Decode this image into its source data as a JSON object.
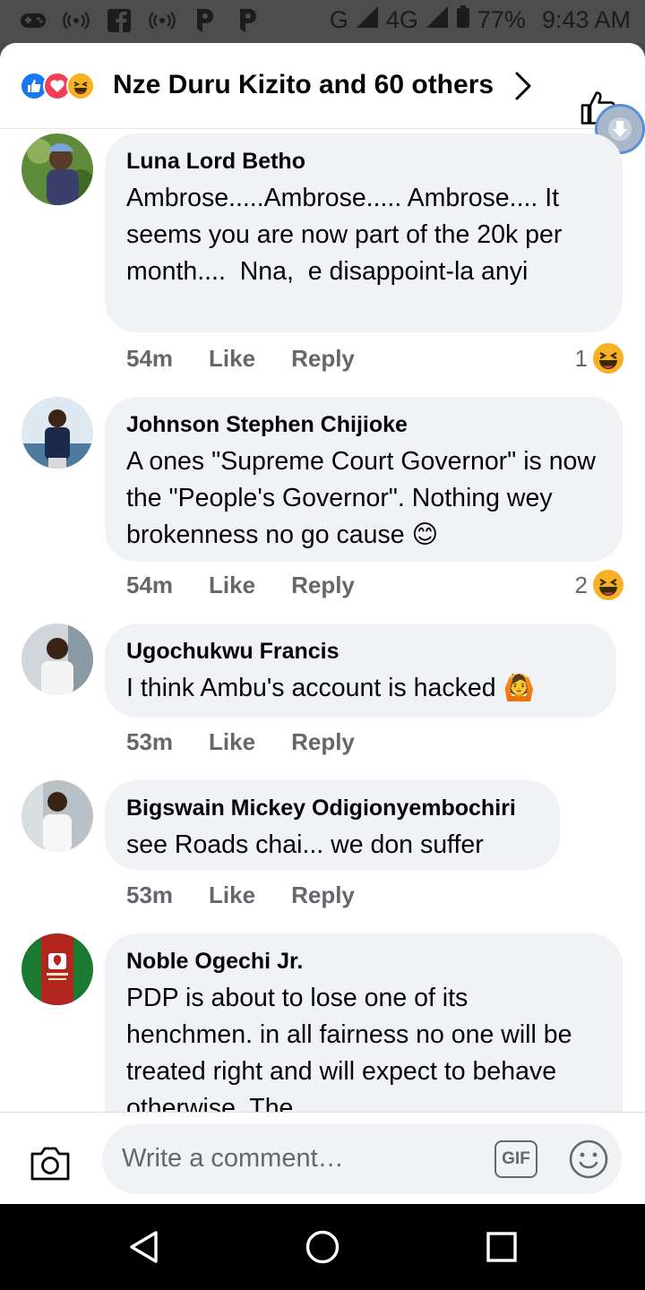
{
  "status_bar": {
    "network": "G",
    "network2": "4G",
    "battery": "77%",
    "time": "9:43 AM"
  },
  "header": {
    "title": "Nze Duru Kizito and 60 others",
    "reaction_icons": [
      "like-icon",
      "love-icon",
      "haha-icon"
    ]
  },
  "comments": [
    {
      "name": "Luna Lord Betho",
      "text": "Ambrose.....Ambrose..... Ambrose.... It seems you are now part of the 20k per month....  Nna,  e disappoint-la anyi",
      "time": "54m",
      "like": "Like",
      "reply": "Reply",
      "reactions": "1"
    },
    {
      "name": "Johnson Stephen Chijioke",
      "text": "A ones \"Supreme Court Governor\" is now the \"People's Governor\". Nothing wey brokenness no go cause 😊",
      "time": "54m",
      "like": "Like",
      "reply": "Reply",
      "reactions": "2"
    },
    {
      "name": "Ugochukwu Francis",
      "text": "I think Ambu's account is hacked 🙆",
      "time": "53m",
      "like": "Like",
      "reply": "Reply"
    },
    {
      "name": "Bigswain Mickey Odigionyembochiri",
      "text": "see Roads chai... we don suffer",
      "time": "53m",
      "like": "Like",
      "reply": "Reply"
    },
    {
      "name": "Noble Ogechi Jr.",
      "text": "PDP is about to lose one of its henchmen. in all fairness no one will be treated right and will expect to behave otherwise. The"
    }
  ],
  "composer": {
    "placeholder": "Write a comment…",
    "gif_label": "GIF"
  },
  "colors": {
    "accent": "#1877f2",
    "bubble": "#f0f2f5",
    "meta_text": "#65676b"
  }
}
